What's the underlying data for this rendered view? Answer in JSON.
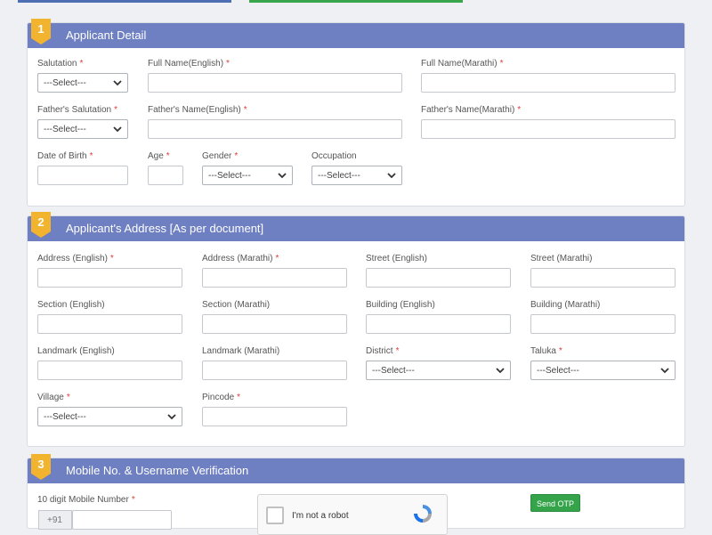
{
  "sections": [
    {
      "number": "1",
      "title": "Applicant Detail"
    },
    {
      "number": "2",
      "title": "Applicant's Address [As per document]"
    },
    {
      "number": "3",
      "title": "Mobile No. & Username Verification"
    }
  ],
  "required_marker": "*",
  "select_placeholder": "---Select---",
  "applicant": {
    "salutation": "Salutation",
    "full_name_en": "Full Name(English)",
    "full_name_mr": "Full Name(Marathi)",
    "father_salutation": "Father's Salutation",
    "father_name_en": "Father's Name(English)",
    "father_name_mr": "Father's Name(Marathi)",
    "dob": "Date of Birth",
    "age": "Age",
    "gender": "Gender",
    "occupation": "Occupation"
  },
  "address": {
    "address_en": "Address (English)",
    "address_mr": "Address (Marathi)",
    "street_en": "Street (English)",
    "street_mr": "Street (Marathi)",
    "section_en": "Section (English)",
    "section_mr": "Section (Marathi)",
    "building_en": "Building (English)",
    "building_mr": "Building (Marathi)",
    "landmark_en": "Landmark (English)",
    "landmark_mr": "Landmark (Marathi)",
    "district": "District",
    "taluka": "Taluka",
    "village": "Village",
    "pincode": "Pincode"
  },
  "mobile": {
    "label": "10 digit Mobile Number",
    "prefix": "+91",
    "captcha_text": "I'm not a robot",
    "send_otp": "Send OTP"
  },
  "colors": {
    "header": "#6e7fc2",
    "badge": "#f2b32f",
    "required": "#e03c3c",
    "otp_button": "#34a34a"
  }
}
